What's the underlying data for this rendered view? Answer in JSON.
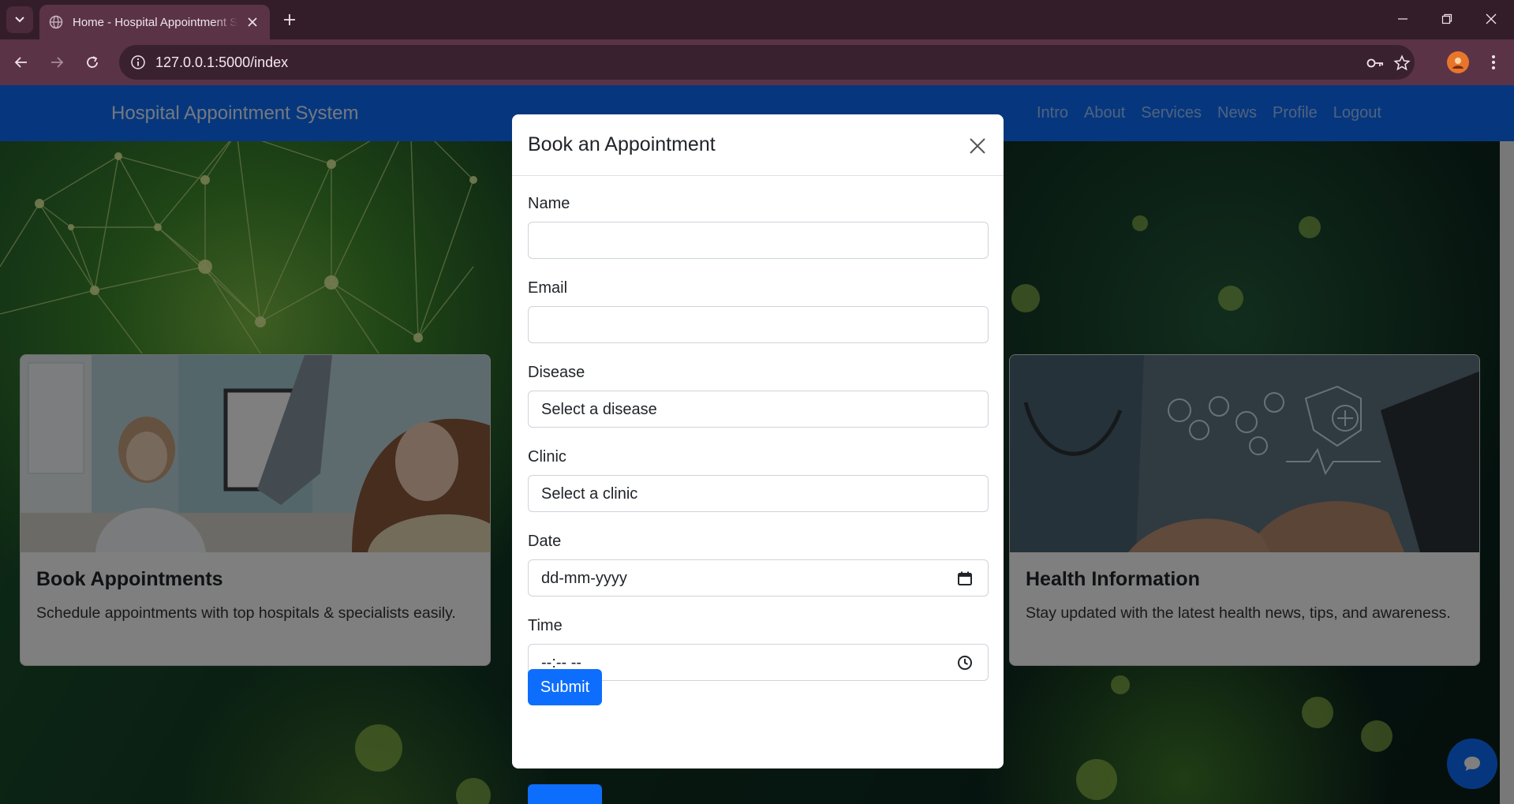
{
  "browser": {
    "tab_title": "Home - Hospital Appointment System",
    "url": "127.0.0.1:5000/index"
  },
  "site": {
    "brand": "Hospital Appointment System",
    "nav": [
      "Intro",
      "About",
      "Services",
      "News",
      "Profile",
      "Logout"
    ],
    "nav_color": "#0d6efd"
  },
  "cards": [
    {
      "title": "Book Appointments",
      "text": "Schedule appointments with top hospitals & specialists easily."
    },
    {
      "title": "Health Information",
      "text": "Stay updated with the latest health news, tips, and awareness."
    }
  ],
  "modal": {
    "title": "Book an Appointment",
    "fields": {
      "name_label": "Name",
      "name_value": "",
      "email_label": "Email",
      "email_value": "",
      "disease_label": "Disease",
      "disease_value": "Select a disease",
      "clinic_label": "Clinic",
      "clinic_value": "Select a clinic",
      "date_label": "Date",
      "date_placeholder": "dd-mm-yyyy",
      "time_label": "Time",
      "time_placeholder": "--:-- --"
    },
    "submit_label": "Submit",
    "accent": "#0d6efd"
  }
}
